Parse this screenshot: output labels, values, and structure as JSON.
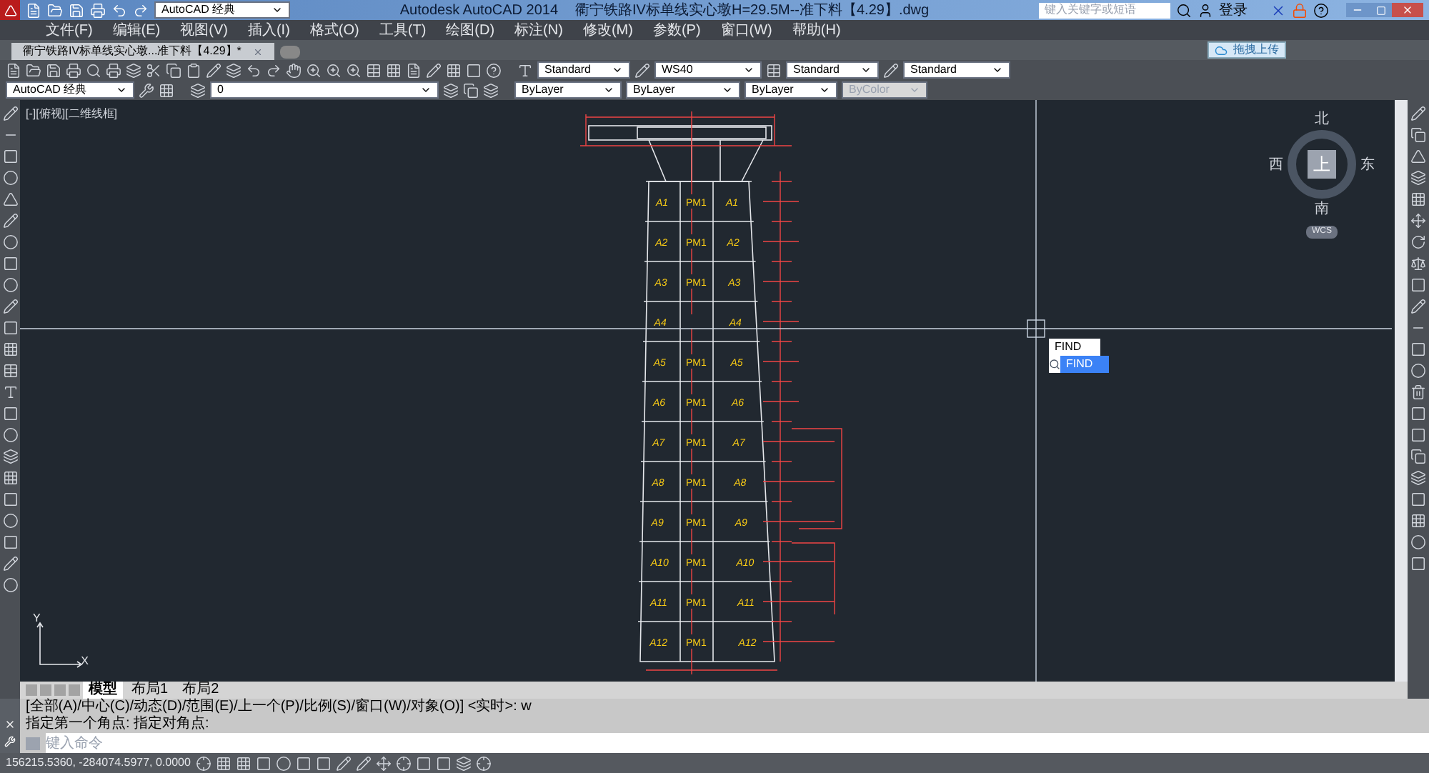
{
  "title_bar": {
    "workspace": "AutoCAD 经典",
    "app": "Autodesk AutoCAD 2014",
    "file": "衢宁铁路IV标单线实心墩H=29.5M--准下料【4.29】.dwg",
    "search": {
      "placeholder": "键入关键字或短语"
    },
    "login": "登录"
  },
  "menu": [
    "文件(F)",
    "编辑(E)",
    "视图(V)",
    "插入(I)",
    "格式(O)",
    "工具(T)",
    "绘图(D)",
    "标注(N)",
    "修改(M)",
    "参数(P)",
    "窗口(W)",
    "帮助(H)"
  ],
  "doc_tabs": [
    {
      "label": "衢宁铁路IV标单线实心墩...准下料【4.29】*",
      "selected": true
    }
  ],
  "upload_button": "拖拽上传",
  "styles_toolbar": {
    "text_style": "Standard",
    "dim_style": "WS40",
    "table_style": "Standard",
    "mleader_style": "Standard"
  },
  "properties_toolbar": {
    "workspace": "AutoCAD 经典",
    "layer": "0",
    "color_setting": "ByLayer",
    "linetype": "ByLayer",
    "lineweight": "ByLayer",
    "plot_style": {
      "value": "ByColor",
      "disabled": true
    }
  },
  "viewport_label": "[-][俯视][二维线框]",
  "viewcube": {
    "north": "北",
    "south": "南",
    "east": "东",
    "west": "西",
    "top": "上",
    "wcs": "WCS"
  },
  "ucs": {
    "y": "Y",
    "x": "X"
  },
  "drawing": {
    "rows": [
      {
        "left": "A1",
        "middle": "PM1",
        "right": "A1"
      },
      {
        "left": "A2",
        "middle": "PM1",
        "right": "A2"
      },
      {
        "left": "A3",
        "middle": "PM1",
        "right": "A3"
      },
      {
        "left": "A4",
        "right": "A4"
      },
      {
        "left": "A5",
        "middle": "PM1",
        "right": "A5"
      },
      {
        "left": "A6",
        "middle": "PM1",
        "right": "A6"
      },
      {
        "left": "A7",
        "middle": "PM1",
        "right": "A7"
      },
      {
        "left": "A8",
        "middle": "PM1",
        "right": "A8"
      },
      {
        "left": "A9",
        "middle": "PM1",
        "right": "A9"
      },
      {
        "left": "A10",
        "middle": "PM1",
        "right": "A10"
      },
      {
        "left": "A11",
        "middle": "PM1",
        "right": "A11"
      },
      {
        "left": "A12",
        "middle": "PM1",
        "right": "A12"
      }
    ]
  },
  "autocomplete": {
    "typed": "FIND",
    "suggestion": "FIND"
  },
  "layout_tabs": [
    {
      "label": "模型",
      "selected": true
    },
    {
      "label": "布局1",
      "selected": false
    },
    {
      "label": "布局2",
      "selected": false
    }
  ],
  "command": {
    "history": [
      "[全部(A)/中心(C)/动态(D)/范围(E)/上一个(P)/比例(S)/窗口(W)/对象(O)] <实时>: w",
      "指定第一个角点: 指定对角点:"
    ],
    "placeholder": "键入命令"
  },
  "status_bar": {
    "coordinates": "156215.5360, -284074.5977, 0.0000"
  }
}
